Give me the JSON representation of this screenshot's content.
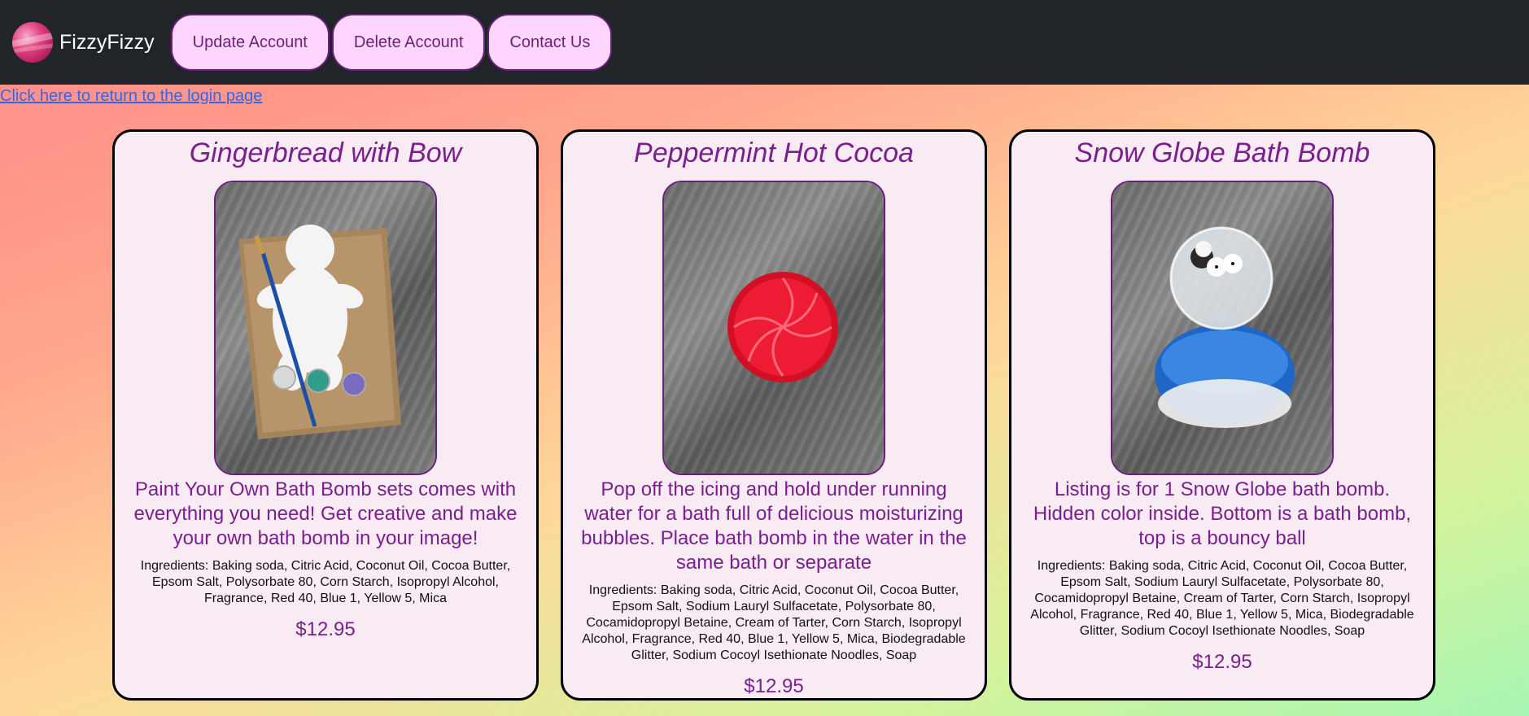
{
  "navbar": {
    "brand": "FizzyFizzy",
    "buttons": [
      "Update Account",
      "Delete Account",
      "Contact Us"
    ]
  },
  "login_link": "Click here to return to the login page",
  "products": [
    {
      "title": "Gingerbread with Bow",
      "image_icon": "gingerbread-bath-bomb-image",
      "description": "Paint Your Own Bath Bomb sets comes with everything you need! Get creative and make your own bath bomb in your image!",
      "ingredients": "Ingredients: Baking soda, Citric Acid, Coconut Oil, Cocoa Butter, Epsom Salt, Polysorbate 80, Corn Starch, Isopropyl Alcohol, Fragrance, Red 40, Blue 1, Yellow 5, Mica",
      "price": "$12.95"
    },
    {
      "title": "Peppermint Hot Cocoa",
      "image_icon": "peppermint-bath-bomb-image",
      "description": "Pop off the icing and hold under running water for a bath full of delicious moisturizing bubbles. Place bath bomb in the water in the same bath or separate",
      "ingredients": "Ingredients: Baking soda, Citric Acid, Coconut Oil, Cocoa Butter, Epsom Salt, Sodium Lauryl Sulfacetate, Polysorbate 80, Cocamidopropyl Betaine, Cream of Tarter, Corn Starch, Isopropyl Alcohol, Fragrance, Red 40, Blue 1, Yellow 5, Mica, Biodegradable Glitter, Sodium Cocoyl Isethionate Noodles, Soap",
      "price": "$12.95"
    },
    {
      "title": "Snow Globe Bath Bomb",
      "image_icon": "snow-globe-bath-bomb-image",
      "description": "Listing is for 1 Snow Globe bath bomb. Hidden color inside. Bottom is a bath bomb, top is a bouncy ball",
      "ingredients": "Ingredients: Baking soda, Citric Acid, Coconut Oil, Cocoa Butter, Epsom Salt, Sodium Lauryl Sulfacetate, Polysorbate 80, Cocamidopropyl Betaine, Cream of Tarter, Corn Starch, Isopropyl Alcohol, Fragrance, Red 40, Blue 1, Yellow 5, Mica, Biodegradable Glitter, Sodium Cocoyl Isethionate Noodles, Soap",
      "price": "$12.95"
    }
  ],
  "colors": {
    "navbar_bg": "#212529",
    "button_bg": "#ffd6ff",
    "accent_purple": "#7b1f8f",
    "card_bg": "#f8ebf3",
    "link": "#3366ee"
  }
}
